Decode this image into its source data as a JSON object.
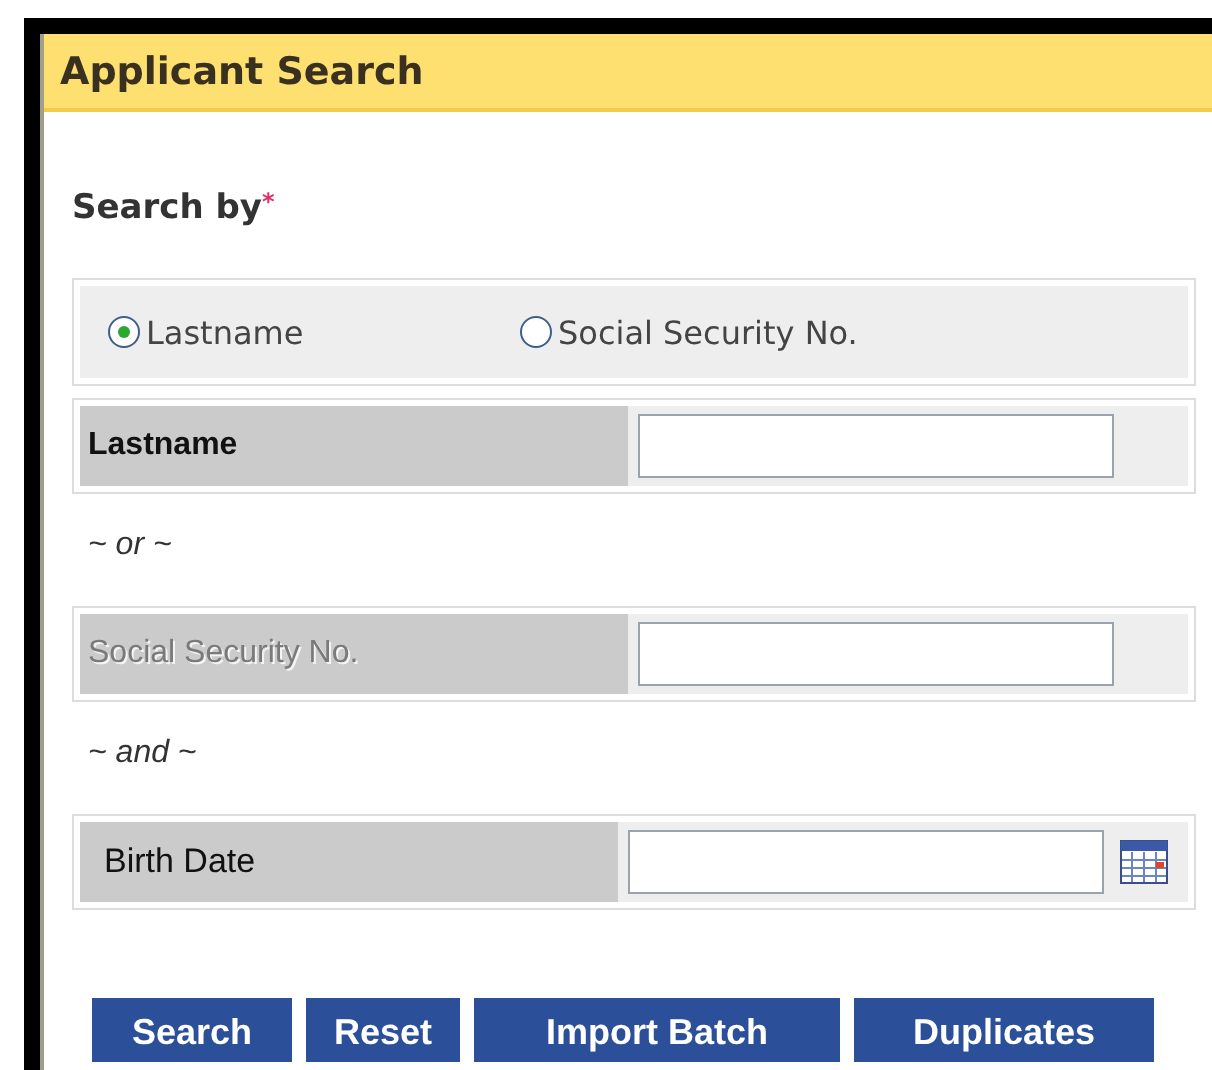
{
  "header": {
    "title": "Applicant Search"
  },
  "search_by": {
    "label": "Search by",
    "required_mark": "*"
  },
  "options": [
    {
      "label": "Lastname",
      "selected": true
    },
    {
      "label": "Social Security No.",
      "selected": false
    }
  ],
  "fields": [
    {
      "kind": "text",
      "label": "Lastname",
      "disabled": false,
      "connector": "~ or ~"
    },
    {
      "kind": "text",
      "label": "Social Security No.",
      "disabled": true,
      "connector": "~ and ~"
    },
    {
      "kind": "date",
      "label": "Birth Date",
      "disabled": false
    }
  ],
  "buttons": [
    "Search",
    "Reset",
    "Import Batch",
    "Duplicates"
  ]
}
